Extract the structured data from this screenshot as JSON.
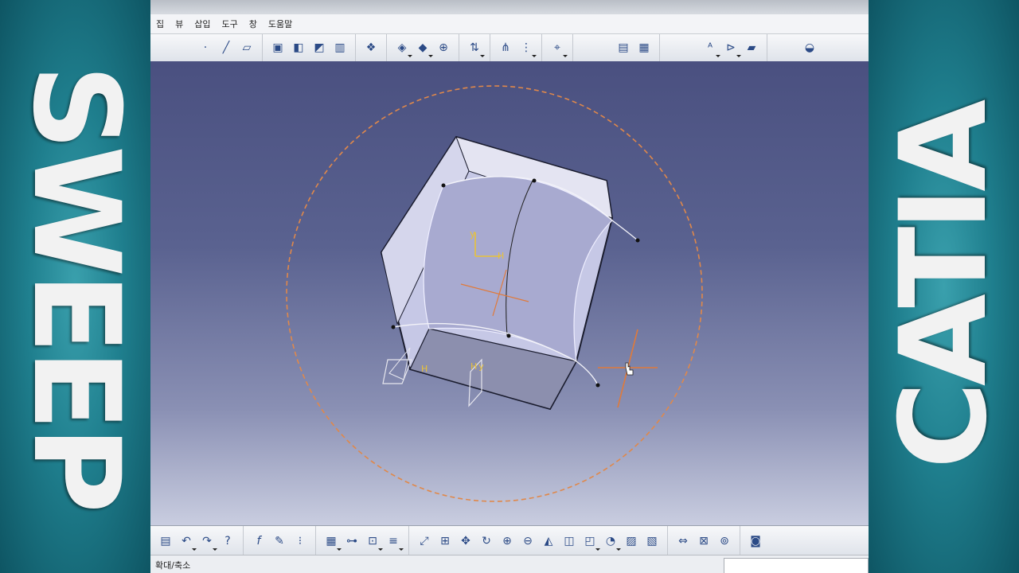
{
  "left_banner": {
    "text": "SWEEP"
  },
  "right_banner": {
    "text": "CATIA"
  },
  "menu": {
    "items": [
      "집",
      "뷰",
      "삽입",
      "도구",
      "창",
      "도움말"
    ]
  },
  "toolbar_top": {
    "groups": [
      {
        "icons": [
          "point-icon",
          "line-icon",
          "plane-icon"
        ]
      },
      {
        "icons": [
          "extrude-icon",
          "offset-icon",
          "sweep-icon",
          "fill-icon"
        ]
      },
      {
        "icons": [
          "join-icon"
        ]
      },
      {
        "icons": [
          "split-icon",
          "trim-icon",
          "boundary-icon"
        ]
      },
      {
        "icons": [
          "translate-icon"
        ]
      },
      {
        "icons": [
          "repetition-icon",
          "pattern-icon"
        ]
      },
      {
        "icons": [
          "axis-system-icon"
        ]
      },
      {
        "icons": [
          "grid-icon",
          "table-icon"
        ]
      },
      {
        "icons": [
          "text-abc-icon",
          "annotation-icon",
          "measure-icon"
        ]
      },
      {
        "icons": [
          "apply-material-icon"
        ]
      }
    ]
  },
  "toolbar_bottom": {
    "icons": [
      "paste-icon",
      "undo-icon",
      "redo-icon",
      "help-icon",
      "formula-icon",
      "comment-icon",
      "knowledge-icon",
      "table-icon",
      "tree-icon",
      "lock-icon",
      "parameters-icon",
      "fit-all-icon",
      "select-icon",
      "pan-icon",
      "rotate-icon",
      "zoom-in-icon",
      "zoom-out-icon",
      "normal-view-icon",
      "iso-view-icon",
      "shading-icon",
      "hide-show-icon",
      "swap-icon",
      "capture-icon",
      "measure-between-icon",
      "measure-item-icon",
      "mass-icon",
      "camera-icon"
    ]
  },
  "status": {
    "text": "확대/축소",
    "input_value": ""
  },
  "viewport": {
    "compass_circle_color": "#e0884a",
    "surface_color": "#b8bbdc",
    "axis_labels": [
      "y",
      "H",
      "H",
      "y",
      "H"
    ]
  }
}
